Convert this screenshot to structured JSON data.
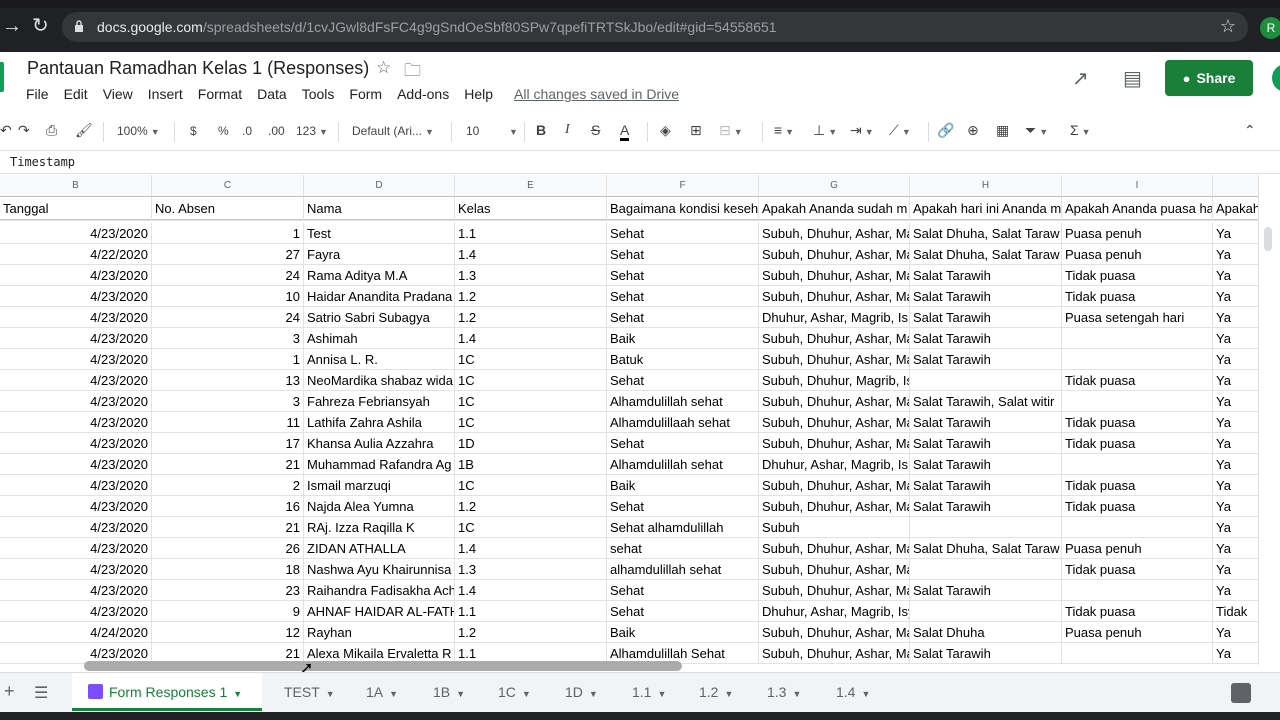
{
  "browser": {
    "url_host": "docs.google.com",
    "url_path": "/spreadsheets/d/1cvJGwl8dFsFC4g9gSndOeSbf80SPw7qpefiTRTSkJbo/edit#gid=54558651",
    "profile_initial": "R"
  },
  "doc": {
    "title": "Pantauan Ramadhan Kelas 1 (Responses)",
    "menu": [
      "File",
      "Edit",
      "View",
      "Insert",
      "Format",
      "Data",
      "Tools",
      "Form",
      "Add-ons",
      "Help"
    ],
    "saved_status": "All changes saved in Drive",
    "share_label": "Share"
  },
  "toolbar": {
    "zoom": "100%",
    "currency": "$",
    "percent": "%",
    "dec_less": ".0",
    "dec_more": ".00",
    "more_formats": "123",
    "font": "Default (Ari...",
    "font_size": "10"
  },
  "formula_bar": {
    "content": "Timestamp"
  },
  "columns": [
    "B",
    "C",
    "D",
    "E",
    "F",
    "G",
    "H",
    "I",
    ""
  ],
  "headers": [
    "Tanggal",
    "No. Absen",
    "Nama",
    "Kelas",
    "Bagaimana kondisi keseh",
    "Apakah Ananda sudah m",
    "Apakah hari ini Ananda m",
    "Apakah Ananda puasa ha",
    "Apakah"
  ],
  "rows": [
    [
      "4/23/2020",
      "1",
      "Test",
      "1.1",
      "Sehat",
      "Subuh, Dhuhur, Ashar, Ma",
      "Salat Dhuha, Salat Taraw",
      "Puasa penuh",
      "Ya"
    ],
    [
      "4/22/2020",
      "27",
      "Fayra",
      "1.4",
      "Sehat",
      "Subuh, Dhuhur, Ashar, Ma",
      "Salat Dhuha, Salat Taraw",
      "Puasa penuh",
      "Ya"
    ],
    [
      "4/23/2020",
      "24",
      "Rama Aditya M.A",
      "1.3",
      "Sehat",
      "Subuh, Dhuhur, Ashar, Ma",
      "Salat Tarawih",
      "Tidak puasa",
      "Ya"
    ],
    [
      "4/23/2020",
      "10",
      "Haidar Anandita Pradana",
      "1.2",
      "Sehat",
      "Subuh, Dhuhur, Ashar, Ma",
      "Salat Tarawih",
      "Tidak puasa",
      "Ya"
    ],
    [
      "4/23/2020",
      "24",
      "Satrio Sabri Subagya",
      "1.2",
      "Sehat",
      "Dhuhur, Ashar, Magrib, Is",
      "Salat Tarawih",
      "Puasa setengah hari",
      "Ya"
    ],
    [
      "4/23/2020",
      "3",
      "Ashimah",
      "1.4",
      "Baik",
      "Subuh, Dhuhur, Ashar, Ma",
      "Salat Tarawih",
      "",
      "Ya"
    ],
    [
      "4/23/2020",
      "1",
      "Annisa L. R.",
      "1C",
      "Batuk",
      "Subuh, Dhuhur, Ashar, Ma",
      "Salat Tarawih",
      "",
      "Ya"
    ],
    [
      "4/23/2020",
      "13",
      "NeoMardika shabaz wida",
      "1C",
      "Sehat",
      "Subuh, Dhuhur, Magrib, Isya",
      "",
      "Tidak puasa",
      "Ya"
    ],
    [
      "4/23/2020",
      "3",
      "Fahreza Febriansyah",
      "1C",
      "Alhamdulillah sehat",
      "Subuh, Dhuhur, Ashar, Ma",
      "Salat Tarawih, Salat witir",
      "",
      "Ya"
    ],
    [
      "4/23/2020",
      "11",
      "Lathifa Zahra Ashila",
      "1C",
      "Alhamdulillaah sehat",
      "Subuh, Dhuhur, Ashar, Ma",
      "Salat Tarawih",
      "Tidak puasa",
      "Ya"
    ],
    [
      "4/23/2020",
      "17",
      "Khansa Aulia Azzahra",
      "1D",
      "Sehat",
      "Subuh, Dhuhur, Ashar, Ma",
      "Salat Tarawih",
      "Tidak puasa",
      "Ya"
    ],
    [
      "4/23/2020",
      "21",
      "Muhammad Rafandra Ag",
      "1B",
      "Alhamdulillah sehat",
      "Dhuhur, Ashar, Magrib, Is",
      "Salat Tarawih",
      "",
      "Ya"
    ],
    [
      "4/23/2020",
      "2",
      "Ismail marzuqi",
      "1C",
      "Baik",
      "Subuh, Dhuhur, Ashar, Ma",
      "Salat Tarawih",
      "Tidak puasa",
      "Ya"
    ],
    [
      "4/23/2020",
      "16",
      "Najda Alea Yumna",
      "1.2",
      "Sehat",
      "Subuh, Dhuhur, Ashar, Ma",
      "Salat Tarawih",
      "Tidak puasa",
      "Ya"
    ],
    [
      "4/23/2020",
      "21",
      "RAj. Izza Raqilla K",
      "1C",
      "Sehat alhamdulillah",
      "Subuh",
      "",
      "",
      "Ya"
    ],
    [
      "4/23/2020",
      "26",
      "ZIDAN ATHALLA",
      "1.4",
      "sehat",
      "Subuh, Dhuhur, Ashar, Ma",
      "Salat Dhuha, Salat Taraw",
      "Puasa penuh",
      "Ya"
    ],
    [
      "4/23/2020",
      "18",
      "Nashwa Ayu Khairunnisa",
      "1.3",
      "alhamdulillah sehat",
      "Subuh, Dhuhur, Ashar, Magrib, Isya",
      "",
      "Tidak puasa",
      "Ya"
    ],
    [
      "4/23/2020",
      "23",
      "Raihandra Fadisakha Ach",
      "1.4",
      "Sehat",
      "Subuh, Dhuhur, Ashar, Ma",
      "Salat Tarawih",
      "",
      "Ya"
    ],
    [
      "4/23/2020",
      "9",
      "AHNAF HAIDAR AL-FATH",
      "1.1",
      "Sehat",
      "Dhuhur, Ashar, Magrib, Isya",
      "",
      "Tidak puasa",
      "Tidak"
    ],
    [
      "4/24/2020",
      "12",
      "Rayhan",
      "1.2",
      "Baik",
      "Subuh, Dhuhur, Ashar, Ma",
      "Salat Dhuha",
      "Puasa penuh",
      "Ya"
    ],
    [
      "4/23/2020",
      "21",
      "Alexa Mikaila Ervaletta R",
      "1.1",
      "Alhamdulillah Sehat",
      "Subuh, Dhuhur, Ashar, Ma",
      "Salat Tarawih",
      "",
      "Ya"
    ]
  ],
  "sheet_tabs": [
    "Form Responses 1",
    "TEST",
    "1A",
    "1B",
    "1C",
    "1D",
    "1.1",
    "1.2",
    "1.3",
    "1.4"
  ]
}
